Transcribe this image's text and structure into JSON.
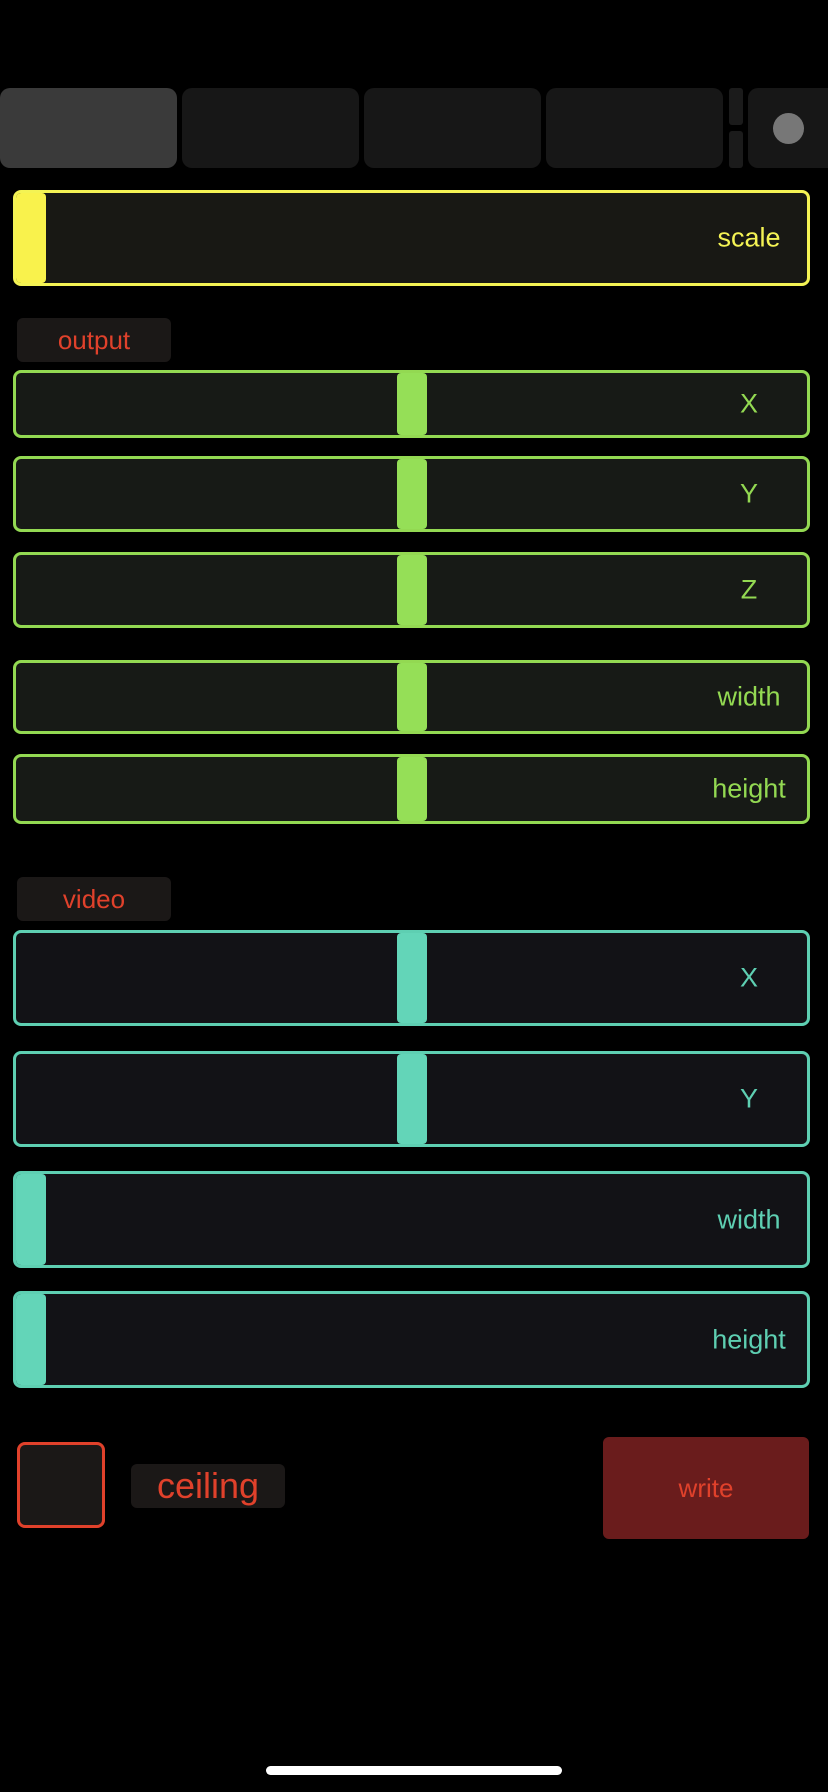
{
  "tabs": [
    {
      "name": "tab-1",
      "active": true
    },
    {
      "name": "tab-2",
      "active": false
    },
    {
      "name": "tab-3",
      "active": false
    },
    {
      "name": "tab-4",
      "active": false
    }
  ],
  "scale": {
    "label": "scale",
    "value": 0.0
  },
  "sections": {
    "output": {
      "label": "output",
      "sliders": [
        {
          "label": "X",
          "value": 0.5
        },
        {
          "label": "Y",
          "value": 0.5
        },
        {
          "label": "Z",
          "value": 0.5
        },
        {
          "label": "width",
          "value": 0.5
        },
        {
          "label": "height",
          "value": 0.5
        }
      ]
    },
    "video": {
      "label": "video",
      "sliders": [
        {
          "label": "X",
          "value": 0.5
        },
        {
          "label": "Y",
          "value": 0.5
        },
        {
          "label": "width",
          "value": 0.0
        },
        {
          "label": "height",
          "value": 0.0
        }
      ]
    }
  },
  "ceiling": {
    "label": "ceiling",
    "checked": false
  },
  "write": {
    "label": "write"
  },
  "colors": {
    "scale": "#f4f354",
    "output": "#93d952",
    "video": "#5ecfb2",
    "accent_red": "#e0412b",
    "write_bg": "#6a1c1c"
  }
}
